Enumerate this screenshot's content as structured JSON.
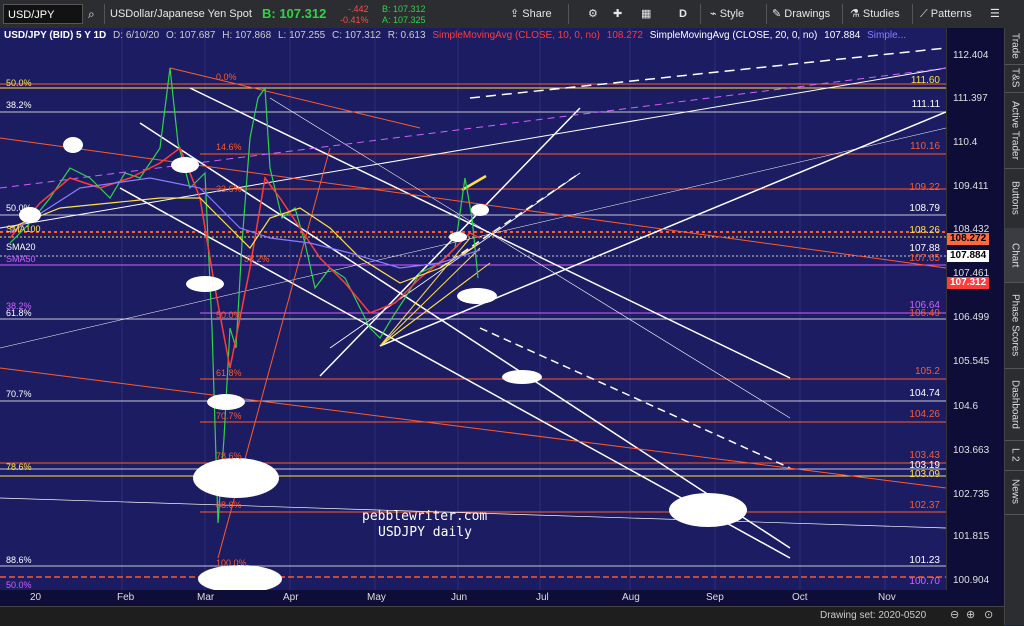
{
  "toolbar": {
    "symbol": "USD/JPY",
    "description": "USDollar/Japanese Yen Spot",
    "last_price": "B: 107.312",
    "change": "-.442",
    "change_pct": "-0.41%",
    "bid": "B: 107.312",
    "ask": "A: 107.325",
    "share": "Share",
    "timeframe": "D",
    "style": "Style",
    "drawings": "Drawings",
    "studies": "Studies",
    "patterns": "Patterns"
  },
  "chart_info": {
    "title": "USD/JPY (BID) 5 Y 1D",
    "date": "D: 6/10/20",
    "open": "O: 107.687",
    "high": "H: 107.868",
    "low": "L: 107.255",
    "close": "C: 107.312",
    "range": "R: 0.613",
    "sma10": "SimpleMovingAvg (CLOSE, 10, 0, no)",
    "sma10_val": "108.272",
    "sma20": "SimpleMovingAvg (CLOSE, 20, 0, no)",
    "sma20_val": "107.884",
    "more": "Simple..."
  },
  "price_axis": [
    "112.404",
    "111.397",
    "110.4",
    "109.411",
    "108.432",
    "107.461",
    "106.499",
    "105.545",
    "104.6",
    "103.663",
    "102.735",
    "101.815",
    "100.904"
  ],
  "price_tags": [
    {
      "text": "108.272",
      "bg": "#ff6a3d",
      "color": "#000"
    },
    {
      "text": "107.884",
      "bg": "#ffffff",
      "color": "#000"
    },
    {
      "text": "107.312",
      "bg": "#ff3b3b",
      "color": "#fff"
    }
  ],
  "time_axis": [
    "20",
    "Feb",
    "Mar",
    "Apr",
    "May",
    "Jun",
    "Jul",
    "Aug",
    "Sep",
    "Oct",
    "Nov"
  ],
  "right_tabs": [
    "Trade",
    "T&S",
    "Active Trader",
    "Buttons",
    "Chart",
    "Phase Scores",
    "Dashboard",
    "L 2",
    "News"
  ],
  "left_labels": {
    "fib50_top": "50.0%",
    "fib382_top": "38.2%",
    "fib50_mid": "50.0%",
    "sma100": "SMA100",
    "sma20": "SMA20",
    "sma50": "SMA50",
    "fib382_mid": "38.2%",
    "fib618_mid": "61.8%",
    "fib707": "70.7%",
    "fib786": "78.6%",
    "fib886": "88.6%",
    "fib50_bot": "50.0%"
  },
  "mid_fibs": [
    "0.0%",
    "14.6%",
    "23.6%",
    "38.2%",
    "50.0%",
    "61.8%",
    "70.7%",
    "78.6%",
    "88.6%",
    "100.0%"
  ],
  "right_price_labels": [
    "111.60",
    "111.11",
    "110.16",
    "109.22",
    "108.79",
    "108.26",
    "107.88",
    "107.65",
    "106.64",
    "106.49",
    "105.2",
    "104.74",
    "104.26",
    "103.43",
    "103.19",
    "103.09",
    "102.37",
    "101.23",
    "100.70"
  ],
  "watermark": {
    "line1": "pebblewriter.com",
    "line2": "USDJPY daily"
  },
  "drawing_set": "Drawing set: 2020-0520",
  "colors": {
    "background": "#1c1c62",
    "fib_orange": "#ff5a2a",
    "fib_yellow": "#ffe14a",
    "fib_magenta": "#d060ff"
  }
}
